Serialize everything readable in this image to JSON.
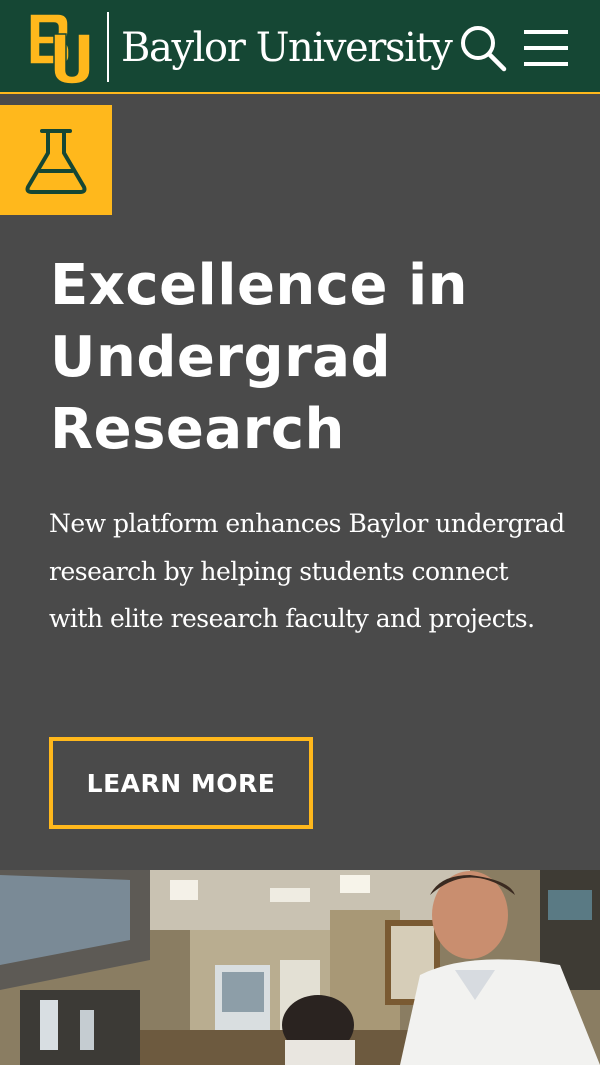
{
  "header": {
    "logo_text": "Baylor University",
    "logo_mark": "BU",
    "search_icon": "search-icon",
    "menu_icon": "hamburger-menu-icon"
  },
  "hero": {
    "icon": "flask-icon",
    "title": "Excellence in Undergrad Research",
    "description": "New platform enhances Baylor undergrad research by helping students connect with elite research faculty and projects.",
    "cta_label": "LEARN MORE"
  },
  "photo": {
    "subject": "laboratory-photo"
  },
  "colors": {
    "brand_green": "#154734",
    "brand_gold": "#ffb81c",
    "hero_bg": "#4a4a4a",
    "text": "#ffffff"
  }
}
